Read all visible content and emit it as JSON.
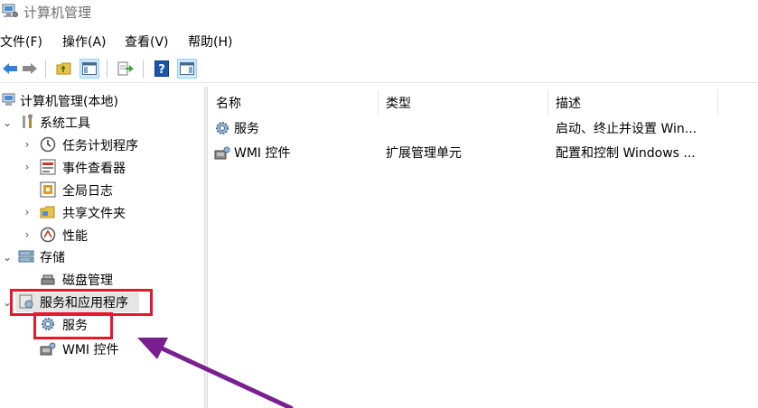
{
  "window": {
    "title": "计算机管理",
    "app_icon": "computer-management-icon"
  },
  "menu": [
    "文件(F)",
    "操作(A)",
    "查看(V)",
    "帮助(H)"
  ],
  "toolbar": {
    "buttons": [
      "back-icon",
      "forward-icon",
      "up-folder-icon",
      "show-hide-tree-icon",
      "export-list-icon",
      "help-icon",
      "show-hide-action-pane-icon"
    ]
  },
  "tree": {
    "root": "计算机管理(本地)",
    "system_tools": {
      "label": "系统工具",
      "children": [
        "任务计划程序",
        "事件查看器",
        "共享文件夹",
        "性能"
      ]
    },
    "global_log": "全局日志",
    "storage": {
      "label": "存储",
      "children": [
        "磁盘管理"
      ]
    },
    "services_apps": {
      "label": "服务和应用程序",
      "children": [
        "服务",
        "WMI 控件"
      ]
    }
  },
  "list": {
    "columns": [
      "名称",
      "类型",
      "描述"
    ],
    "rows": [
      {
        "name": "服务",
        "type": "",
        "desc": "启动、终止并设置 Win..."
      },
      {
        "name": "WMI 控件",
        "type": "扩展管理单元",
        "desc": "配置和控制 Windows ..."
      }
    ]
  },
  "annotation": {
    "highlight_color": "#e8182a",
    "arrow_color": "#7a1f8f"
  }
}
